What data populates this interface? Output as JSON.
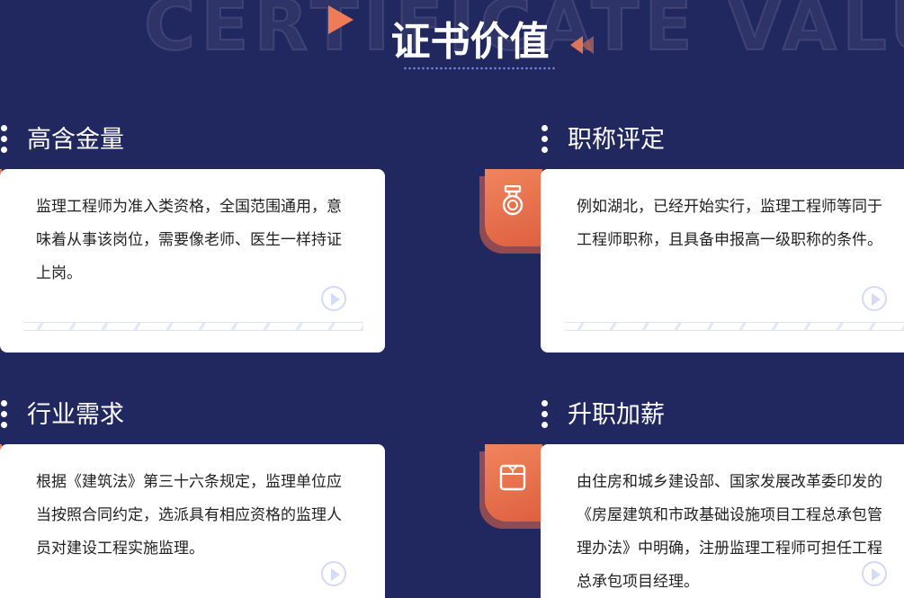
{
  "header": {
    "bg_word": "CERTIFICATE VALUE",
    "title": "证书价值"
  },
  "colors": {
    "background": "#21285f",
    "accent": "#ef7c56",
    "card": "#ffffff"
  },
  "sections": [
    {
      "title": "高含金量",
      "text": "监理工程师为准入类资格，全国范围通用，意味着从事该岗位，需要像老师、医生一样持证上岗。"
    },
    {
      "title": "职称评定",
      "icon": "medal-icon",
      "text": "例如湖北，已经开始实行，监理工程师等同于工程师职称，且具备申报高一级职称的条件。"
    },
    {
      "title": "行业需求",
      "text": "根据《建筑法》第三十六条规定，监理单位应当按照合同约定，选派具有相应资格的监理人员对建设工程实施监理。"
    },
    {
      "title": "升职加薪",
      "icon": "wallet-icon",
      "text": "由住房和城乡建设部、国家发展改革委印发的《房屋建筑和市政基础设施项目工程总承包管理办法》中明确，注册监理工程师可担任工程总承包项目经理。"
    }
  ]
}
